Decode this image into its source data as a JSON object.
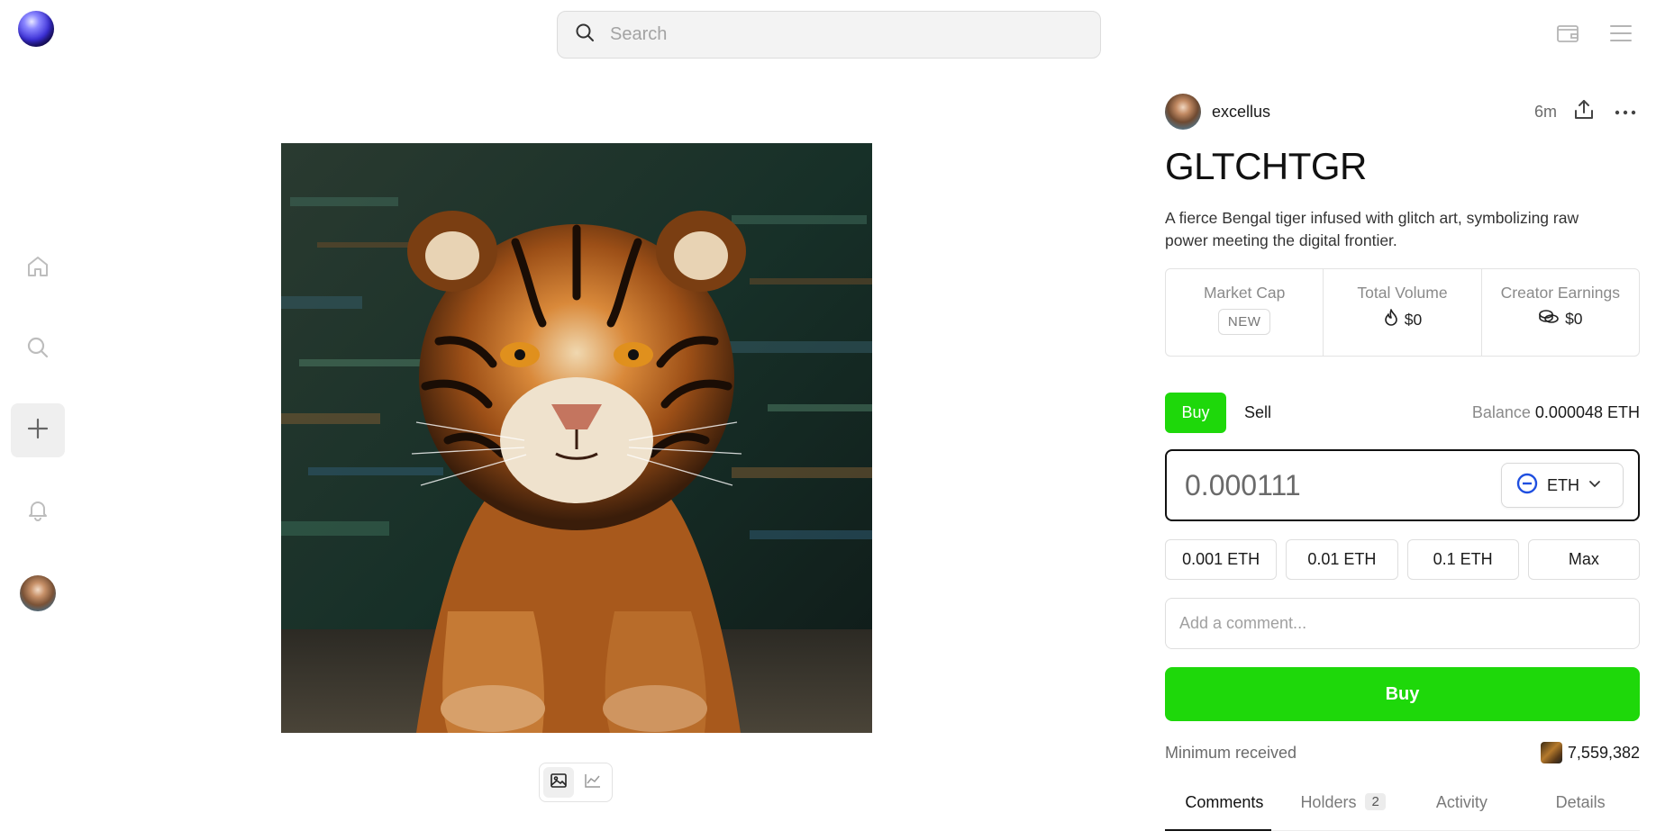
{
  "header": {
    "search_placeholder": "Search",
    "logo_icon": "globe-logo",
    "wallet_icon": "wallet-icon",
    "menu_icon": "hamburger-menu-icon"
  },
  "sidebar": {
    "items": [
      {
        "name": "home",
        "icon": "home-icon",
        "active": false
      },
      {
        "name": "search",
        "icon": "search-icon",
        "active": false
      },
      {
        "name": "create",
        "icon": "plus-icon",
        "active": true
      },
      {
        "name": "notifications",
        "icon": "bell-icon",
        "active": false
      }
    ],
    "profile_icon": "avatar"
  },
  "artwork": {
    "subject": "tiger",
    "view_modes": [
      "image-icon",
      "chart-icon"
    ],
    "active_view": "image"
  },
  "post": {
    "creator": "excellus",
    "age": "6m",
    "title": "GLTCHTGR",
    "description": "A fierce Bengal tiger infused with glitch art, symbolizing raw power meeting the digital frontier."
  },
  "stats": {
    "market_cap_label": "Market Cap",
    "market_cap_badge": "NEW",
    "total_volume_label": "Total Volume",
    "total_volume_value": "$0",
    "creator_earnings_label": "Creator Earnings",
    "creator_earnings_value": "$0"
  },
  "trade": {
    "buy_tab": "Buy",
    "sell_tab": "Sell",
    "balance_label": "Balance",
    "balance_value": "0.000048 ETH",
    "amount": "0.000111",
    "currency": "ETH",
    "presets": [
      "0.001 ETH",
      "0.01 ETH",
      "0.1 ETH",
      "Max"
    ],
    "comment_placeholder": "Add a comment...",
    "buy_button": "Buy",
    "min_received_label": "Minimum received",
    "min_received_value": "7,559,382"
  },
  "tabs": [
    {
      "label": "Comments",
      "active": true
    },
    {
      "label": "Holders",
      "count": "2"
    },
    {
      "label": "Activity"
    },
    {
      "label": "Details"
    }
  ],
  "colors": {
    "accent_green": "#1ed80a",
    "eth_blue": "#1f4fe0"
  }
}
